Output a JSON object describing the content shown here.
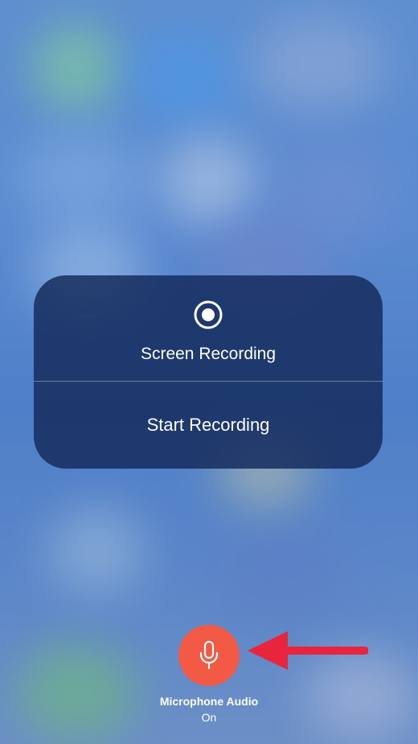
{
  "panel": {
    "title": "Screen Recording",
    "action_label": "Start Recording",
    "icon": "record-icon"
  },
  "microphone": {
    "icon": "microphone-icon",
    "label": "Microphone Audio",
    "status": "On"
  },
  "annotation": {
    "icon": "arrow-left-icon"
  },
  "colors": {
    "mic_button": "#f25a45",
    "arrow": "#e8253c",
    "panel_background": "#142b5c"
  }
}
